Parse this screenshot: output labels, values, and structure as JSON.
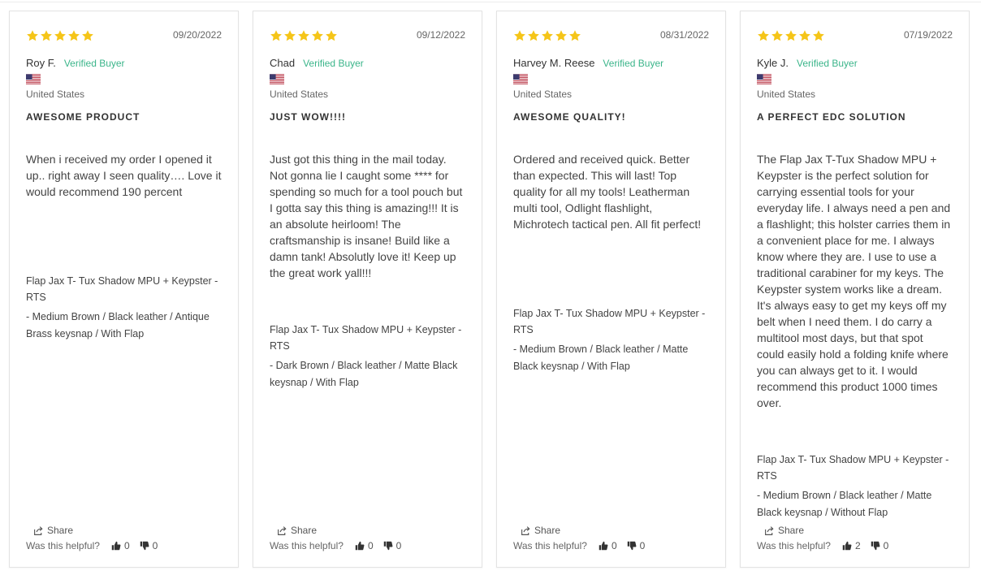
{
  "colors": {
    "star": "#f5c518",
    "verified": "#3bb58a",
    "text": "#333333",
    "muted": "#666666",
    "border": "#e3e3e3"
  },
  "reviews": [
    {
      "rating": 5,
      "date": "09/20/2022",
      "name": "Roy F.",
      "verified": "Verified Buyer",
      "country": "United States",
      "title": "AWESOME PRODUCT",
      "body": "When i received my order I opened it up.. right away I seen quality…. Love it would recommend 190 percent",
      "product": "Flap Jax T- Tux Shadow MPU + Keypster - RTS",
      "variant": "- Medium Brown / Black leather / Antique Brass keysnap / With Flap",
      "share": "Share",
      "helpful": "Was this helpful?",
      "up": "0",
      "down": "0"
    },
    {
      "rating": 5,
      "date": "09/12/2022",
      "name": "Chad",
      "verified": "Verified Buyer",
      "country": "United States",
      "title": "JUST WOW!!!!",
      "body": "Just got this thing in the mail today. Not gonna lie I caught some **** for spending so much for a tool pouch but I gotta say this thing is amazing!!! It is an absolute heirloom! The craftsmanship is insane! Build like a damn tank! Absolutly love it! Keep up the great work yall!!!",
      "product": "Flap Jax T- Tux Shadow MPU + Keypster - RTS",
      "variant": "- Dark Brown / Black leather / Matte Black keysnap / With Flap",
      "share": "Share",
      "helpful": "Was this helpful?",
      "up": "0",
      "down": "0"
    },
    {
      "rating": 5,
      "date": "08/31/2022",
      "name": "Harvey M. Reese",
      "verified": "Verified Buyer",
      "country": "United States",
      "title": "AWESOME QUALITY!",
      "body": "Ordered and received quick. Better than expected. This will last! Top quality for all my tools! Leatherman multi tool, Odlight flashlight, Michrotech tactical pen. All fit perfect!",
      "product": "Flap Jax T- Tux Shadow MPU + Keypster - RTS",
      "variant": "- Medium Brown / Black leather / Matte Black keysnap / With Flap",
      "share": "Share",
      "helpful": "Was this helpful?",
      "up": "0",
      "down": "0"
    },
    {
      "rating": 5,
      "date": "07/19/2022",
      "name": "Kyle J.",
      "verified": "Verified Buyer",
      "country": "United States",
      "title": "A PERFECT EDC SOLUTION",
      "body": "The Flap Jax T-Tux Shadow MPU + Keypster is the perfect solution for carrying essential tools for your everyday life. I always need a pen and a flashlight; this holster carries them in a convenient place for me. I always know where they are. I use to use a traditional carabiner for my keys. The Keypster system works like a dream. It's always easy to get my keys off my belt when I need them. I do carry a multitool most days, but that spot could easily hold a folding knife where you can always get to it. I would recommend this product 1000 times over.",
      "product": "Flap Jax T- Tux Shadow MPU + Keypster - RTS",
      "variant": "- Medium Brown / Black leather / Matte Black keysnap / Without Flap",
      "share": "Share",
      "helpful": "Was this helpful?",
      "up": "2",
      "down": "0"
    }
  ]
}
